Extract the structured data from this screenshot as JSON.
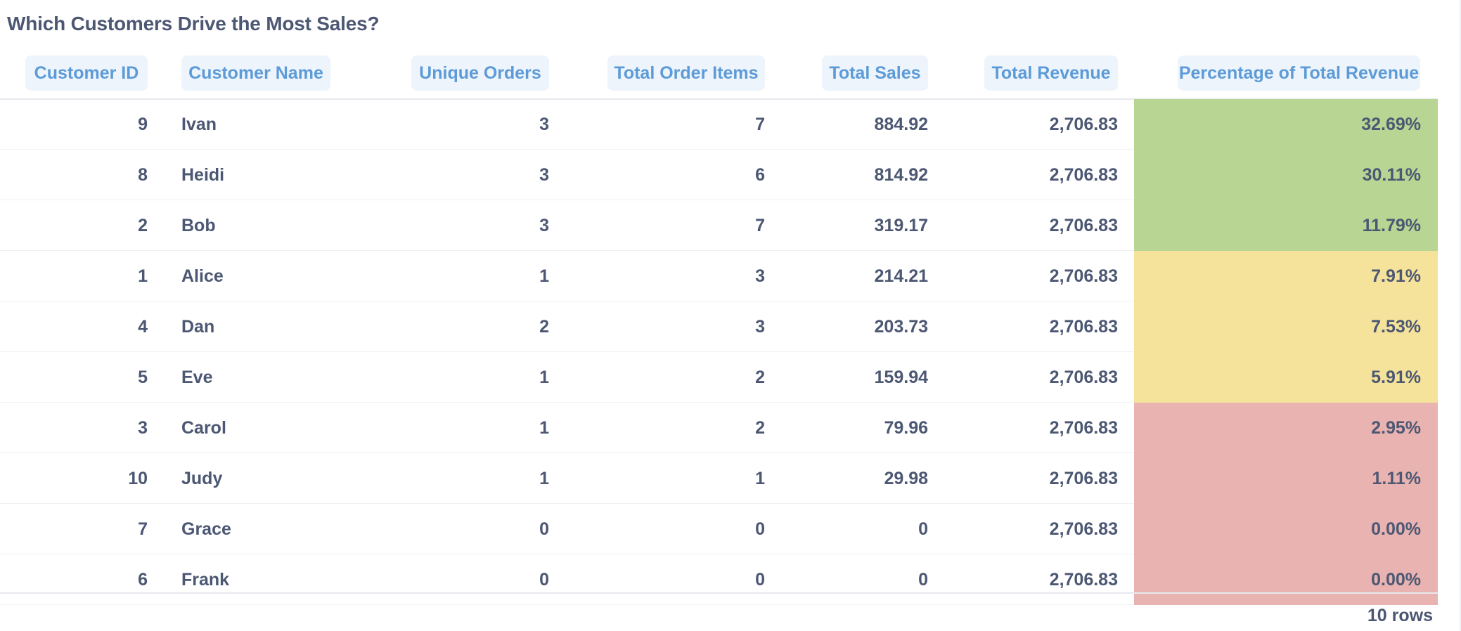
{
  "title": "Which Customers Drive the Most Sales?",
  "columns": [
    "Customer ID",
    "Customer Name",
    "Unique Orders",
    "Total Order Items",
    "Total Sales",
    "Total Revenue",
    "Percentage of Total Revenue"
  ],
  "rows": [
    {
      "customer_id": "9",
      "customer_name": "Ivan",
      "unique_orders": "3",
      "total_order_items": "7",
      "total_sales": "884.92",
      "total_revenue": "2,706.83",
      "pct_total_revenue": "32.69%",
      "band": "high"
    },
    {
      "customer_id": "8",
      "customer_name": "Heidi",
      "unique_orders": "3",
      "total_order_items": "6",
      "total_sales": "814.92",
      "total_revenue": "2,706.83",
      "pct_total_revenue": "30.11%",
      "band": "high"
    },
    {
      "customer_id": "2",
      "customer_name": "Bob",
      "unique_orders": "3",
      "total_order_items": "7",
      "total_sales": "319.17",
      "total_revenue": "2,706.83",
      "pct_total_revenue": "11.79%",
      "band": "high"
    },
    {
      "customer_id": "1",
      "customer_name": "Alice",
      "unique_orders": "1",
      "total_order_items": "3",
      "total_sales": "214.21",
      "total_revenue": "2,706.83",
      "pct_total_revenue": "7.91%",
      "band": "mid"
    },
    {
      "customer_id": "4",
      "customer_name": "Dan",
      "unique_orders": "2",
      "total_order_items": "3",
      "total_sales": "203.73",
      "total_revenue": "2,706.83",
      "pct_total_revenue": "7.53%",
      "band": "mid"
    },
    {
      "customer_id": "5",
      "customer_name": "Eve",
      "unique_orders": "1",
      "total_order_items": "2",
      "total_sales": "159.94",
      "total_revenue": "2,706.83",
      "pct_total_revenue": "5.91%",
      "band": "mid"
    },
    {
      "customer_id": "3",
      "customer_name": "Carol",
      "unique_orders": "1",
      "total_order_items": "2",
      "total_sales": "79.96",
      "total_revenue": "2,706.83",
      "pct_total_revenue": "2.95%",
      "band": "low"
    },
    {
      "customer_id": "10",
      "customer_name": "Judy",
      "unique_orders": "1",
      "total_order_items": "1",
      "total_sales": "29.98",
      "total_revenue": "2,706.83",
      "pct_total_revenue": "1.11%",
      "band": "low"
    },
    {
      "customer_id": "7",
      "customer_name": "Grace",
      "unique_orders": "0",
      "total_order_items": "0",
      "total_sales": "0",
      "total_revenue": "2,706.83",
      "pct_total_revenue": "0.00%",
      "band": "low"
    },
    {
      "customer_id": "6",
      "customer_name": "Frank",
      "unique_orders": "0",
      "total_order_items": "0",
      "total_sales": "0",
      "total_revenue": "2,706.83",
      "pct_total_revenue": "0.00%",
      "band": "low"
    }
  ],
  "band_colors": {
    "high": "#b9d593",
    "mid": "#f5e39b",
    "low": "#e9b3b1"
  },
  "header_color": "#5c9bd8",
  "footer": {
    "row_count": "10 rows"
  }
}
